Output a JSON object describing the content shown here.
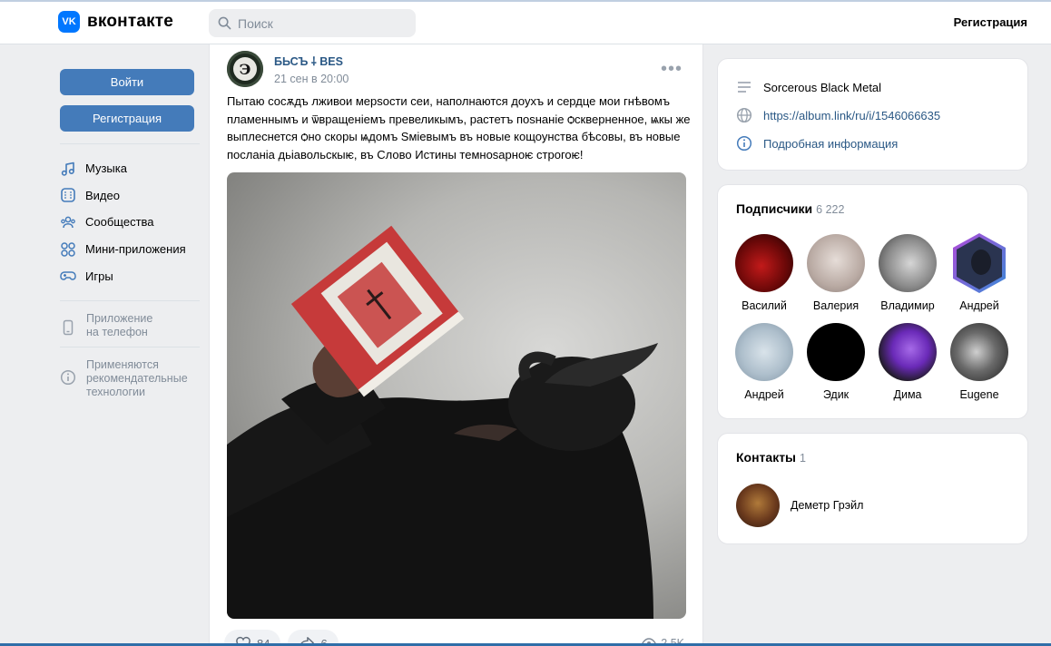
{
  "header": {
    "logo_badge": "VK",
    "logo_text": "вконтакте",
    "search_placeholder": "Поиск",
    "register_link": "Регистрация"
  },
  "sidebar": {
    "login_button": "Войти",
    "register_button": "Регистрация",
    "items": [
      {
        "label": "Музыка",
        "icon": "music-icon"
      },
      {
        "label": "Видео",
        "icon": "video-icon"
      },
      {
        "label": "Сообщества",
        "icon": "communities-icon"
      },
      {
        "label": "Мини-приложения",
        "icon": "mini-apps-icon"
      },
      {
        "label": "Игры",
        "icon": "games-icon"
      }
    ],
    "app_line1": "Приложение",
    "app_line2": "на телефон",
    "rec_line1": "Применяются",
    "rec_line2": "рекомендательные",
    "rec_line3": "технологии"
  },
  "post": {
    "avatar_letter": "Э",
    "author": "БЬСЪ ⸸ BES",
    "date": "21 сен в 20:00",
    "more": "•••",
    "text": "Пытаю сосѫдъ лживои мерѕости сеи, наполнаются доухъ и сердце мои гнѣвомъ пламеннымъ и ѿвращенiемъ превеликымъ, растетъ поѕнанiе ѻскверненное, ѩкы же выплеснется ѻно скоры ѩдомъ Ѕмiевымъ въ новые кощоунства бѣсовы, въ новые посланiа дьiавольскыѥ, въ Слово Истины темноѕарноѥ строгоѥ!",
    "likes": "84",
    "shares": "6",
    "views": "2,5K"
  },
  "info": {
    "description": "Sorcerous Black Metal",
    "url": "https://album.link/ru/i/1546066635",
    "details": "Подробная информация"
  },
  "subscribers": {
    "title": "Подписчики",
    "count": "6 222",
    "people": [
      {
        "name": "Василий",
        "color": "#8a1010"
      },
      {
        "name": "Валерия",
        "color": "#c7bdb8"
      },
      {
        "name": "Владимир",
        "color": "#9a9a9a"
      },
      {
        "name": "Андрей",
        "color": "#3a4a7a"
      },
      {
        "name": "Андрей",
        "color": "#b9c9d6"
      },
      {
        "name": "Эдик",
        "color": "#000000"
      },
      {
        "name": "Дима",
        "color": "#8a4ad8"
      },
      {
        "name": "Eugene",
        "color": "#4a4a4a"
      }
    ]
  },
  "contacts": {
    "title": "Контакты",
    "count": "1",
    "name": "Деметр Грэйл"
  }
}
